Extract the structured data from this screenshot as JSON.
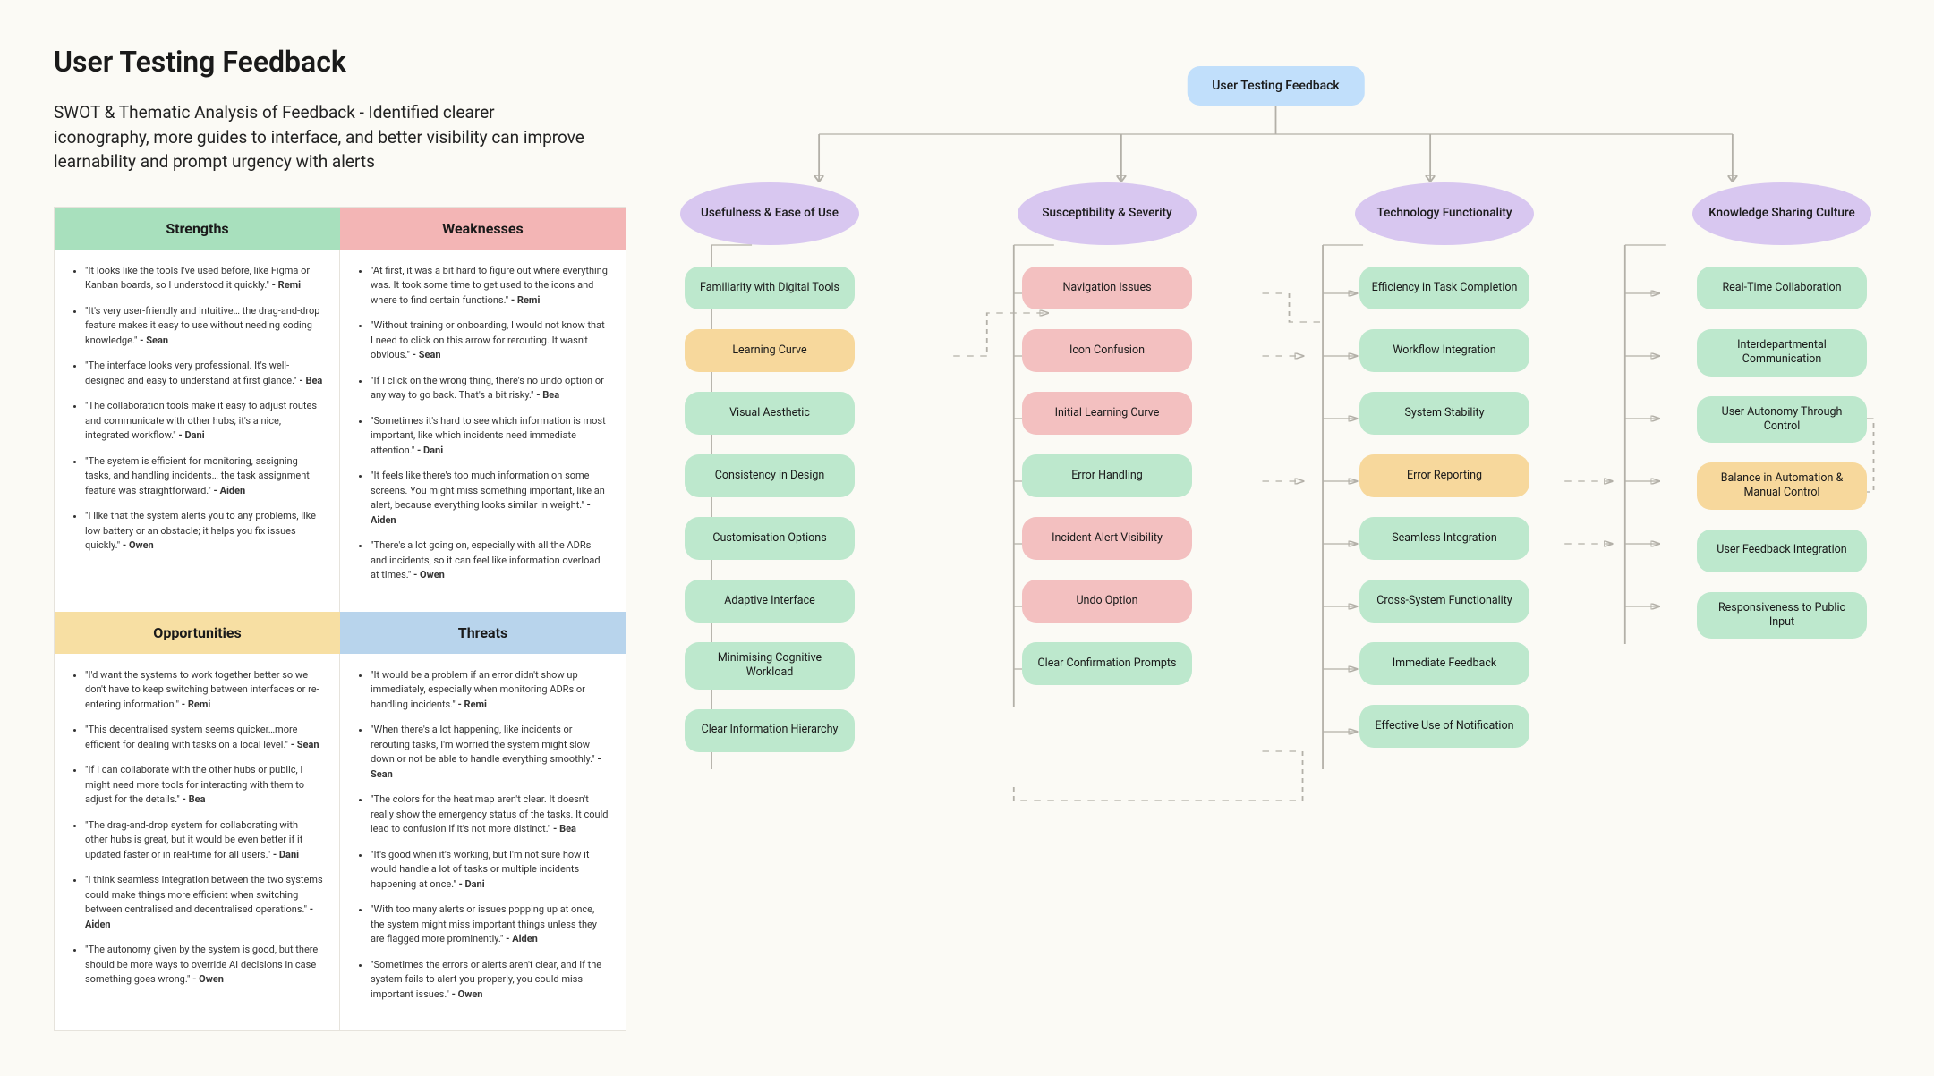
{
  "title": "User Testing Feedback",
  "subtitle": "SWOT & Thematic Analysis of Feedback - Identified clearer iconography, more guides to interface, and better visibility can improve learnability and prompt urgency with alerts",
  "swot": {
    "strengths": {
      "label": "Strengths",
      "items": [
        {
          "quote": "\"It looks like the tools I've used before, like Figma or Kanban boards, so I understood it quickly.\"",
          "author": "Remi"
        },
        {
          "quote": "\"It's very user-friendly and intuitive… the drag-and-drop feature makes it easy to use without needing coding knowledge.\"",
          "author": "Sean"
        },
        {
          "quote": "\"The interface looks very professional. It's well-designed and easy to understand at first glance.\"",
          "author": "Bea"
        },
        {
          "quote": "\"The collaboration tools make it easy to adjust routes and communicate with other hubs; it's a nice, integrated workflow.\"",
          "author": "Dani"
        },
        {
          "quote": "\"The system is efficient for monitoring, assigning tasks, and handling incidents… the task assignment feature was straightforward.\"",
          "author": "Aiden"
        },
        {
          "quote": "\"I like that the system alerts you to any problems, like low battery or an obstacle; it helps you fix issues quickly.\"",
          "author": "Owen"
        }
      ]
    },
    "weaknesses": {
      "label": "Weaknesses",
      "items": [
        {
          "quote": "\"At first, it was a bit hard to figure out where everything was. It took some time to get used to the icons and where to find certain functions.\"",
          "author": "Remi"
        },
        {
          "quote": "\"Without training or onboarding, I would not know that I need to click on this arrow for rerouting. It wasn't obvious.\"",
          "author": "Sean"
        },
        {
          "quote": "\"If I click on the wrong thing, there's no undo option or any way to go back. That's a bit risky.\"",
          "author": "Bea"
        },
        {
          "quote": "\"Sometimes it's hard to see which information is most important, like which incidents need immediate attention.\"",
          "author": "Dani"
        },
        {
          "quote": "\"It feels like there's too much information on some screens. You might miss something important, like an alert, because everything looks similar in weight.\"",
          "author": "Aiden"
        },
        {
          "quote": "\"There's a lot going on, especially with all the ADRs and incidents, so it can feel like information overload at times.\"",
          "author": "Owen"
        }
      ]
    },
    "opportunities": {
      "label": "Opportunities",
      "items": [
        {
          "quote": "\"I'd want the systems to work together better so we don't have to keep switching between interfaces or re-entering information.\"",
          "author": "Remi"
        },
        {
          "quote": "\"This decentralised system seems quicker…more efficient for dealing with tasks on a local level.\"",
          "author": "Sean"
        },
        {
          "quote": "\"If I can collaborate with the other hubs or public, I might need more tools for interacting with them to adjust for the details.\"",
          "author": "Bea"
        },
        {
          "quote": "\"The drag-and-drop system for collaborating with other hubs is great, but it would be even better if it updated faster or in real-time for all users.\"",
          "author": "Dani"
        },
        {
          "quote": "\"I think seamless integration between the two systems could make things more efficient when switching between centralised and decentralised operations.\"",
          "author": "Aiden"
        },
        {
          "quote": "\"The autonomy given by the system is good, but there should be more ways to override AI decisions in case something goes wrong.\"",
          "author": "Owen"
        }
      ]
    },
    "threats": {
      "label": "Threats",
      "items": [
        {
          "quote": "\"It would be a problem if an error didn't show up immediately, especially when monitoring ADRs or handling incidents.\"",
          "author": "Remi"
        },
        {
          "quote": "\"When there's a lot happening, like incidents or rerouting tasks, I'm worried the system might slow down or not be able to handle everything smoothly.\"",
          "author": "Sean"
        },
        {
          "quote": "\"The colors for the heat map aren't clear. It doesn't really show the emergency status of the tasks. It could lead to confusion if it's not more distinct.\"",
          "author": "Bea"
        },
        {
          "quote": "\"It's good when it's working, but I'm not sure how it would handle a lot of tasks or multiple incidents happening at once.\"",
          "author": "Dani"
        },
        {
          "quote": "\"With too many alerts or issues popping up at once, the system might miss important things unless they are flagged more prominently.\"",
          "author": "Aiden"
        },
        {
          "quote": "\"Sometimes the errors or alerts aren't clear, and if the system fails to alert you properly, you could miss important issues.\"",
          "author": "Owen"
        }
      ]
    }
  },
  "diagram": {
    "root": "User Testing Feedback",
    "categories": [
      {
        "label": "Usefulness & Ease of Use",
        "themes": [
          {
            "label": "Familiarity with Digital Tools",
            "color": "green"
          },
          {
            "label": "Learning Curve",
            "color": "orange"
          },
          {
            "label": "Visual Aesthetic",
            "color": "green"
          },
          {
            "label": "Consistency in Design",
            "color": "green"
          },
          {
            "label": "Customisation Options",
            "color": "green"
          },
          {
            "label": "Adaptive Interface",
            "color": "green"
          },
          {
            "label": "Minimising Cognitive Workload",
            "color": "green"
          },
          {
            "label": "Clear Information Hierarchy",
            "color": "green"
          }
        ]
      },
      {
        "label": "Susceptibility & Severity",
        "themes": [
          {
            "label": "Navigation Issues",
            "color": "pink"
          },
          {
            "label": "Icon Confusion",
            "color": "pink"
          },
          {
            "label": "Initial Learning Curve",
            "color": "pink"
          },
          {
            "label": "Error Handling",
            "color": "green"
          },
          {
            "label": "Incident Alert Visibility",
            "color": "pink"
          },
          {
            "label": "Undo Option",
            "color": "pink"
          },
          {
            "label": "Clear Confirmation Prompts",
            "color": "green"
          }
        ]
      },
      {
        "label": "Technology Functionality",
        "themes": [
          {
            "label": "Efficiency in Task Completion",
            "color": "green"
          },
          {
            "label": "Workflow Integration",
            "color": "green"
          },
          {
            "label": "System Stability",
            "color": "green"
          },
          {
            "label": "Error Reporting",
            "color": "orange"
          },
          {
            "label": "Seamless Integration",
            "color": "green"
          },
          {
            "label": "Cross-System Functionality",
            "color": "green"
          },
          {
            "label": "Immediate Feedback",
            "color": "green"
          },
          {
            "label": "Effective Use of Notification",
            "color": "green"
          }
        ]
      },
      {
        "label": "Knowledge Sharing Culture",
        "themes": [
          {
            "label": "Real-Time Collaboration",
            "color": "green"
          },
          {
            "label": "Interdepartmental Communication",
            "color": "green"
          },
          {
            "label": "User Autonomy Through Control",
            "color": "green"
          },
          {
            "label": "Balance in Automation & Manual Control",
            "color": "orange"
          },
          {
            "label": "User Feedback Integration",
            "color": "green"
          },
          {
            "label": "Responsiveness to Public Input",
            "color": "green"
          }
        ]
      }
    ]
  }
}
